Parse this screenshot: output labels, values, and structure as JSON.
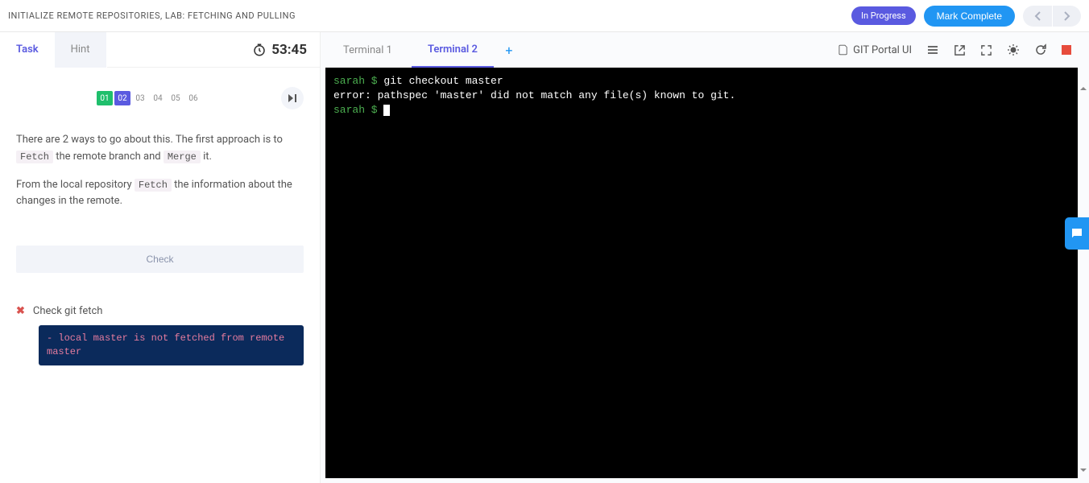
{
  "header": {
    "title": "INITIALIZE REMOTE REPOSITORIES, LAB: FETCHING AND PULLING",
    "status_badge": "In Progress",
    "mark_complete_label": "Mark Complete"
  },
  "left": {
    "tabs": {
      "task": "Task",
      "hint": "Hint"
    },
    "timer": "53:45",
    "steps": [
      "01",
      "02",
      "03",
      "04",
      "05",
      "06"
    ],
    "task_paragraph_1_pre": "There are 2 ways to go about this. The first approach is to ",
    "task_code_1": "Fetch",
    "task_paragraph_1_mid": " the remote branch and ",
    "task_code_2": "Merge",
    "task_paragraph_1_post": " it.",
    "task_paragraph_2_pre": "From the local repository ",
    "task_code_3": "Fetch",
    "task_paragraph_2_post": " the information about the changes in the remote.",
    "check_button": "Check",
    "check_result_label": "Check git fetch",
    "error_message": "- local master is not fetched from remote master"
  },
  "right": {
    "tabs": {
      "t1": "Terminal 1",
      "t2": "Terminal 2"
    },
    "portal_label": "GIT Portal UI",
    "terminal": {
      "line1_user": "sarah $",
      "line1_cmd": " git checkout master",
      "line2": "error: pathspec 'master' did not match any file(s) known to git.",
      "line3_user": "sarah $",
      "line3_cmd": " "
    }
  }
}
